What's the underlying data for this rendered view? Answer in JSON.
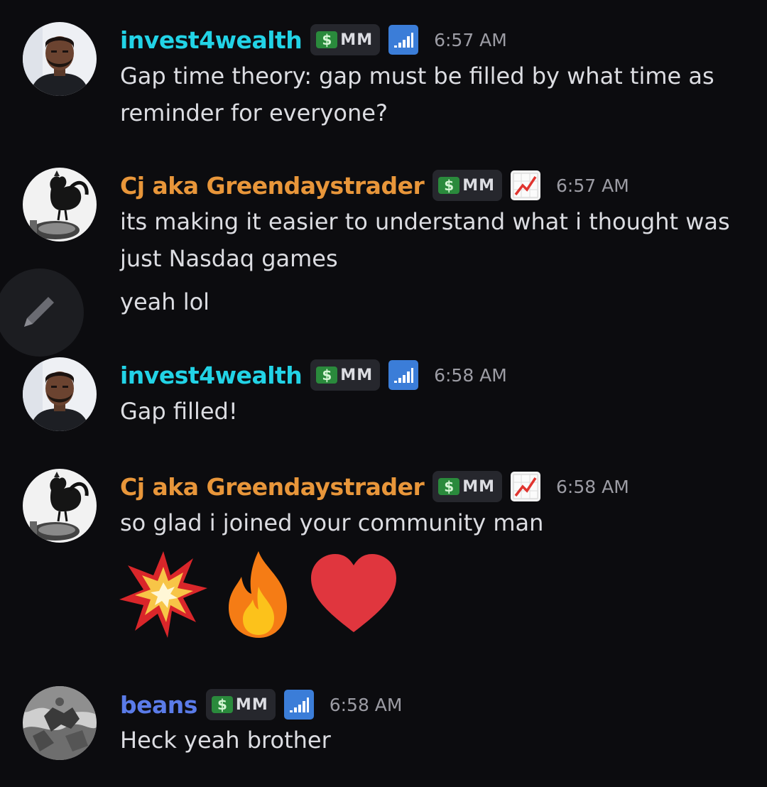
{
  "badge_money_glyph": "$",
  "badge_tag": "MM",
  "colors": {
    "invest4wealth": "#22d3e6",
    "greenday": "#e8963a",
    "beans": "#5a7be8",
    "background": "#0c0c0f"
  },
  "messages": [
    {
      "username": "invest4wealth",
      "role_icon": "signal-bars-icon",
      "time": "6:57 AM",
      "lines": [
        "Gap time theory: gap must be filled by what time as",
        "reminder for everyone?"
      ]
    },
    {
      "username": "Cj aka Greendaystrader",
      "role_icon": "chart-increasing-icon",
      "time": "6:57 AM",
      "lines": [
        "its making it easier to understand what i thought was",
        "just Nasdaq games"
      ],
      "followup": "yeah lol"
    },
    {
      "username": "invest4wealth",
      "role_icon": "signal-bars-icon",
      "time": "6:58 AM",
      "lines": [
        "Gap filled!"
      ]
    },
    {
      "username": "Cj aka Greendaystrader",
      "role_icon": "chart-increasing-icon",
      "time": "6:58 AM",
      "lines": [
        "so glad i joined your community man"
      ],
      "emojis": [
        "collision-emoji",
        "fire-emoji",
        "red-heart-emoji"
      ]
    },
    {
      "username": "beans",
      "role_icon": "signal-bars-icon",
      "time": "6:58 AM",
      "lines": [
        "Heck yeah brother"
      ]
    }
  ],
  "edit_button_icon": "pencil-icon"
}
